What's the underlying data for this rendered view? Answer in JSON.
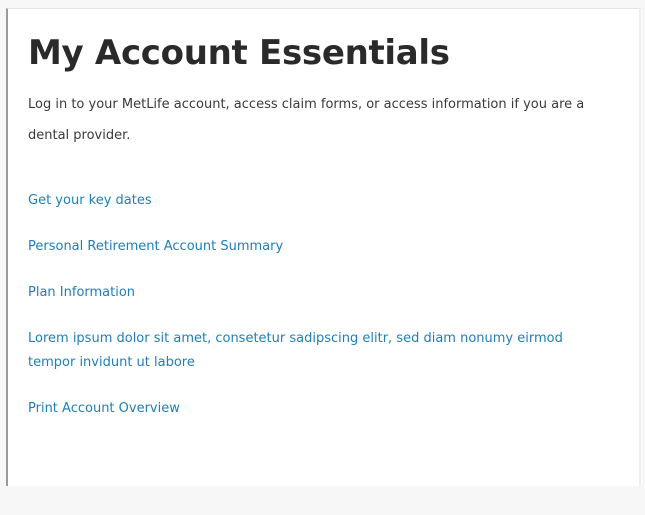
{
  "card": {
    "title": "My Account Essentials",
    "description": "Log in to your MetLife account, access claim forms, or access information if you are a dental provider.",
    "links": [
      {
        "label": "Get your key dates"
      },
      {
        "label": "Personal Retirement Account Summary"
      },
      {
        "label": "Plan Information"
      },
      {
        "label": "Lorem ipsum dolor sit amet, consetetur sadipscing elitr, sed diam nonumy eirmod tempor invidunt ut labore"
      },
      {
        "label": "Print Account Overview"
      }
    ]
  },
  "colors": {
    "link": "#1f7fb6",
    "title": "#2a2a2a",
    "text": "#3a3a3a",
    "border": "#9a9a9a"
  }
}
